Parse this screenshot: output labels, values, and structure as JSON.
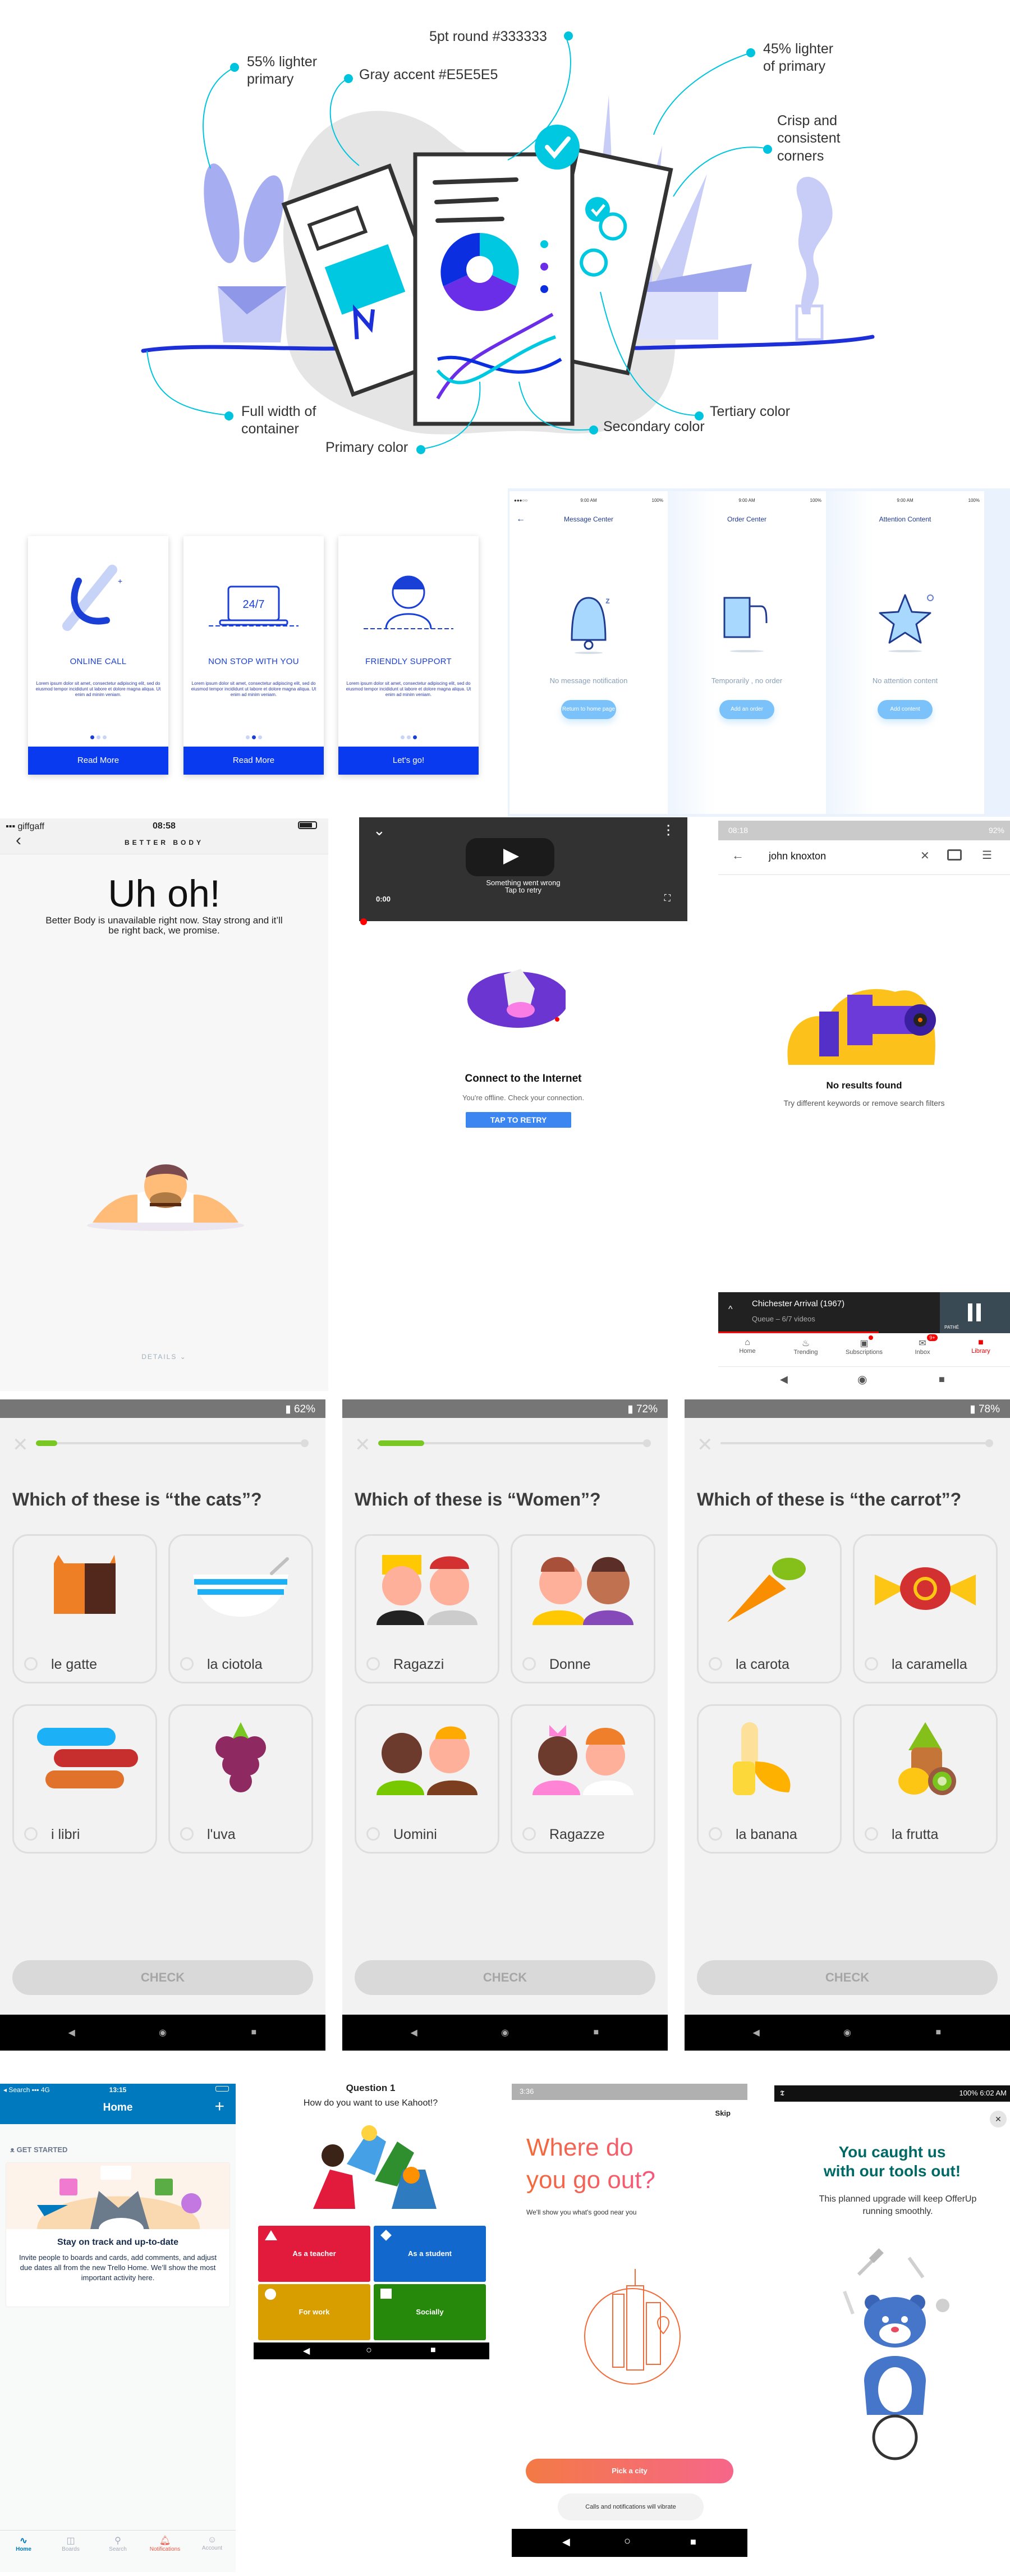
{
  "style_guide": {
    "annotations": {
      "lighter_55": "55% lighter\nprimary",
      "gray_accent": "Gray accent #E5E5E5",
      "round_5pt": "5pt round #333333",
      "lighter_45": "45% lighter\nof primary",
      "crisp": "Crisp and\nconsistent\ncorners",
      "full_width": "Full width of\ncontainer",
      "tertiary": "Tertiary color",
      "secondary": "Secondary color",
      "primary": "Primary color"
    },
    "colors": {
      "primary": "#6a2ee8",
      "secondary": "#0a2ee0",
      "tertiary": "#00c8e0",
      "gray_accent": "#E5E5E5",
      "stroke": "#333333",
      "light_primary": "#a6adf0"
    }
  },
  "onboarding": {
    "cards": [
      {
        "title": "ONLINE CALL",
        "text": "Lorem ipsum dolor sit amet, consectetur adipiscing elit, sed do eiusmod tempor incididunt ut labore et dolore magna aliqua. Ut enim ad minim veniam.",
        "active_dot": 0,
        "button": "Read More"
      },
      {
        "title": "NON STOP WITH YOU",
        "text": "Lorem ipsum dolor sit amet, consectetur adipiscing elit, sed do eiusmod tempor incididunt ut labore et dolore magna aliqua. Ut enim ad minim veniam.",
        "active_dot": 1,
        "button": "Read More"
      },
      {
        "title": "FRIENDLY SUPPORT",
        "text": "Lorem ipsum dolor sit amet, consectetur adipiscing elit, sed do eiusmod tempor incididunt ut labore et dolore magna aliqua. Ut enim ad minim veniam.",
        "active_dot": 2,
        "button": "Let's go!"
      }
    ],
    "laptop_text": "24/7"
  },
  "empty_states": {
    "time": "9:00 AM",
    "battery": "100%",
    "screens": [
      {
        "title": "Message Center",
        "message": "No message notification",
        "button": "Return to home page"
      },
      {
        "title": "Order Center",
        "message": "Temporarily , no order",
        "button": "Add an order"
      },
      {
        "title": "Attention Content",
        "message": "No attention content",
        "button": "Add  content"
      }
    ]
  },
  "better_body": {
    "carrier": "giffgaff",
    "time": "08:58",
    "title": "BETTER BODY",
    "heading": "Uh oh!",
    "message": "Better Body is unavailable right now. Stay strong and it’ll be right back, we promise.",
    "details": "DETAILS"
  },
  "youtube_offline": {
    "player_error": "Something went wrong",
    "player_retry": "Tap to retry",
    "time": "0:00",
    "heading": "Connect to the Internet",
    "message": "You're offline. Check your connection.",
    "button": "TAP TO RETRY"
  },
  "youtube_search": {
    "time": "08:18",
    "battery": "92%",
    "query": "john knoxton",
    "heading": "No results found",
    "message": "Try different keywords or remove search filters",
    "mini_player": {
      "title": "Chichester Arrival (1967)",
      "subtitle": "Queue – 6/7 videos",
      "thumb_label": "PATHÉ",
      "progress": 0.55
    },
    "tabs": [
      {
        "label": "Home",
        "icon": "home-icon",
        "active": false
      },
      {
        "label": "Trending",
        "icon": "flame-icon",
        "active": false
      },
      {
        "label": "Subscriptions",
        "icon": "subscriptions-icon",
        "active": false
      },
      {
        "label": "Inbox",
        "icon": "inbox-icon",
        "active": false,
        "badge": "9+"
      },
      {
        "label": "Library",
        "icon": "folder-icon",
        "active": true
      }
    ]
  },
  "duolingo": [
    {
      "battery": "62%",
      "progress": 0.08,
      "question": "Which of these is “the cats”?",
      "options": [
        "le gatte",
        "la ciotola",
        "i libri",
        "l'uva"
      ],
      "check": "CHECK"
    },
    {
      "battery": "72%",
      "progress": 0.17,
      "question": "Which of these is “Women”?",
      "options": [
        "Ragazzi",
        "Donne",
        "Uomini",
        "Ragazze"
      ],
      "check": "CHECK"
    },
    {
      "battery": "78%",
      "progress": 0.0,
      "question": "Which of these is “the carrot”?",
      "options": [
        "la carota",
        "la caramella",
        "la banana",
        "la frutta"
      ],
      "check": "CHECK"
    }
  ],
  "trello": {
    "back_label": "Search",
    "network": "4G",
    "time": "13:15",
    "title": "Home",
    "section": "GET STARTED",
    "card_title": "Stay on track and up-to-date",
    "card_text": "Invite people to boards and cards, add comments, and adjust due dates all from the new Trello Home. We’ll show the most important activity here.",
    "tabs": [
      {
        "label": "Home",
        "active": true
      },
      {
        "label": "Boards"
      },
      {
        "label": "Search"
      },
      {
        "label": "Notifications",
        "alert": true
      },
      {
        "label": "Account"
      }
    ]
  },
  "kahoot": {
    "question_number": "Question 1",
    "question": "How do you want to use Kahoot!?",
    "answers": [
      {
        "label": "As a teacher",
        "shape": "triangle",
        "color": "#e21b3c"
      },
      {
        "label": "As a student",
        "shape": "diamond",
        "color": "#1368ce"
      },
      {
        "label": "For work",
        "shape": "circle",
        "color": "#d89e00"
      },
      {
        "label": "Socially",
        "shape": "square",
        "color": "#26890c"
      }
    ]
  },
  "foursquare": {
    "time": "3:36",
    "skip": "Skip",
    "heading_line1": "Where do",
    "heading_line2": "you go out?",
    "subtitle": "We'll show you what's good near you",
    "button": "Pick a city",
    "toast": "Calls and notifications will vibrate"
  },
  "offerup": {
    "status_right": "100%  6:02 AM",
    "heading_line1": "You caught us",
    "heading_line2": "with our tools out!",
    "message": "This planned upgrade will keep OfferUp running smoothly."
  }
}
